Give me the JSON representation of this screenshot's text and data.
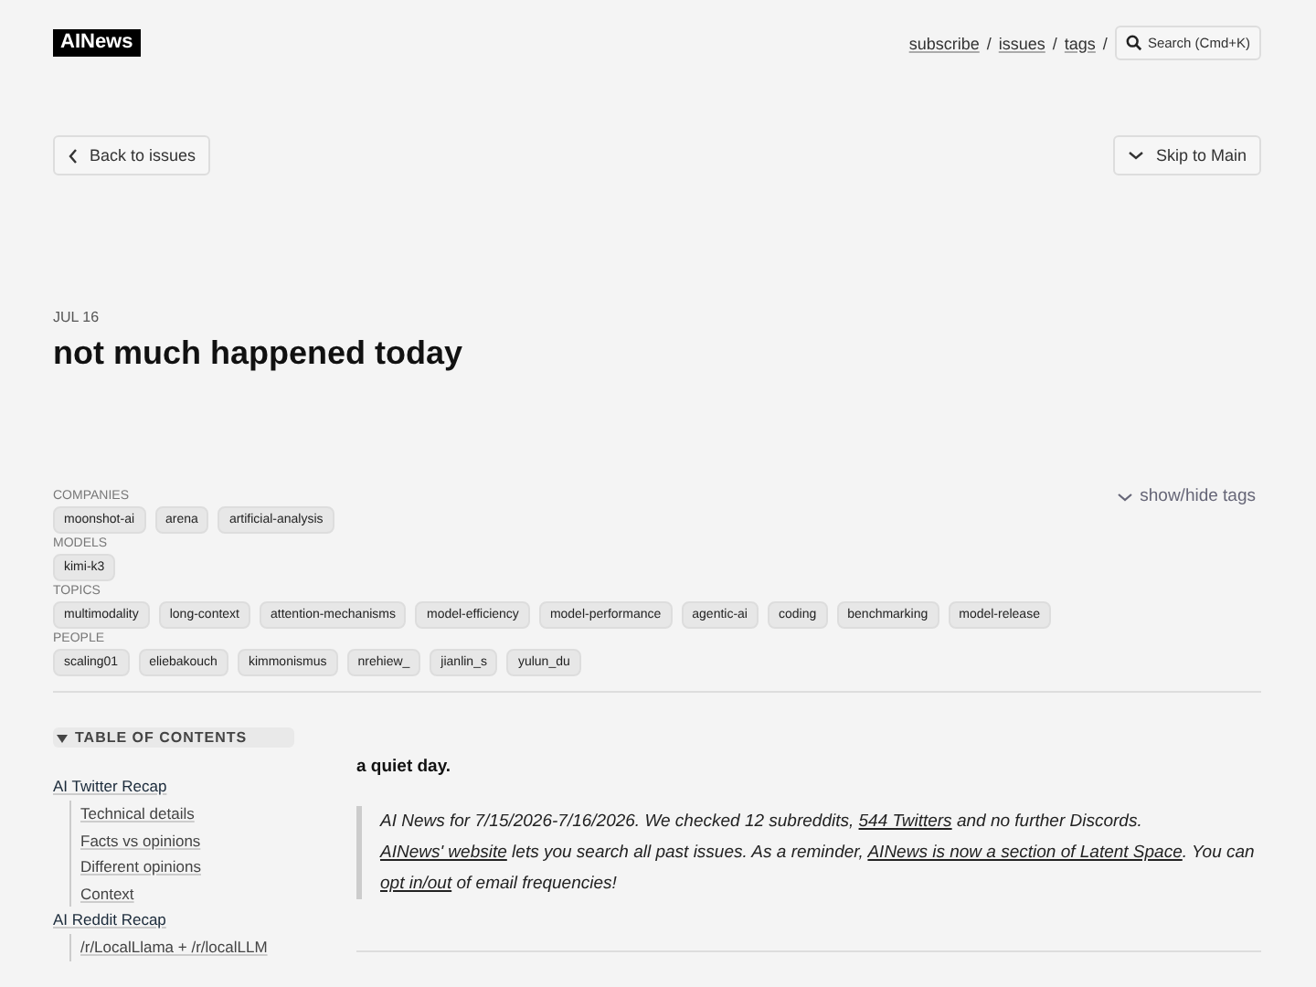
{
  "header": {
    "logo": "AINews",
    "nav": [
      {
        "label": "subscribe",
        "separator": "/"
      },
      {
        "label": "issues",
        "separator": "/"
      },
      {
        "label": "tags",
        "separator": "/"
      }
    ],
    "search": {
      "label": "Search (Cmd+K)"
    }
  },
  "back_button": {
    "label": "Back to issues"
  },
  "skip_button": {
    "label": "Skip to Main"
  },
  "issue": {
    "date": "JUL 16",
    "title": "not much happened today"
  },
  "tags": {
    "toggle": "show/hide tags",
    "groups": [
      {
        "label": "COMPANIES",
        "tags": [
          "moonshot-ai",
          "arena",
          "artificial-analysis"
        ]
      },
      {
        "label": "MODELS",
        "tags": [
          "kimi-k3"
        ]
      },
      {
        "label": "TOPICS",
        "tags": [
          "multimodality",
          "long-context",
          "attention-mechanisms",
          "model-efficiency",
          "model-performance",
          "agentic-ai",
          "coding",
          "benchmarking",
          "model-release"
        ]
      },
      {
        "label": "PEOPLE",
        "tags": [
          "scaling01",
          "eliebakouch",
          "kimmonismus",
          "nrehiew_",
          "jianlin_s",
          "yulun_du"
        ]
      }
    ]
  },
  "toc": {
    "title": "TABLE OF CONTENTS",
    "expanded": true,
    "sections": [
      {
        "label": "AI Twitter Recap",
        "children": [
          {
            "label": "Technical details"
          },
          {
            "label": "Facts vs opinions"
          },
          {
            "label": "Different opinions"
          },
          {
            "label": "Context"
          }
        ]
      },
      {
        "label": "AI Reddit Recap",
        "children": [
          {
            "label": "/r/LocalLlama + /r/localLLM"
          }
        ]
      }
    ]
  },
  "content": {
    "lead": "a quiet day.",
    "note": [
      {
        "text": "AI News for 7/15/2026-7/16/2026. We checked 12 subreddits, ",
        "link": false
      },
      {
        "text": "544 Twitters",
        "link": true
      },
      {
        "text": " and no further Discords. ",
        "link": false
      },
      {
        "text": "AINews' website",
        "link": true
      },
      {
        "text": " lets you search all past issues. As a reminder, ",
        "link": false
      },
      {
        "text": "AINews is now a section of Latent Space",
        "link": true
      },
      {
        "text": ". You can ",
        "link": false
      },
      {
        "text": "opt in/out",
        "link": true
      },
      {
        "text": " of email frequencies!",
        "link": false
      }
    ]
  }
}
